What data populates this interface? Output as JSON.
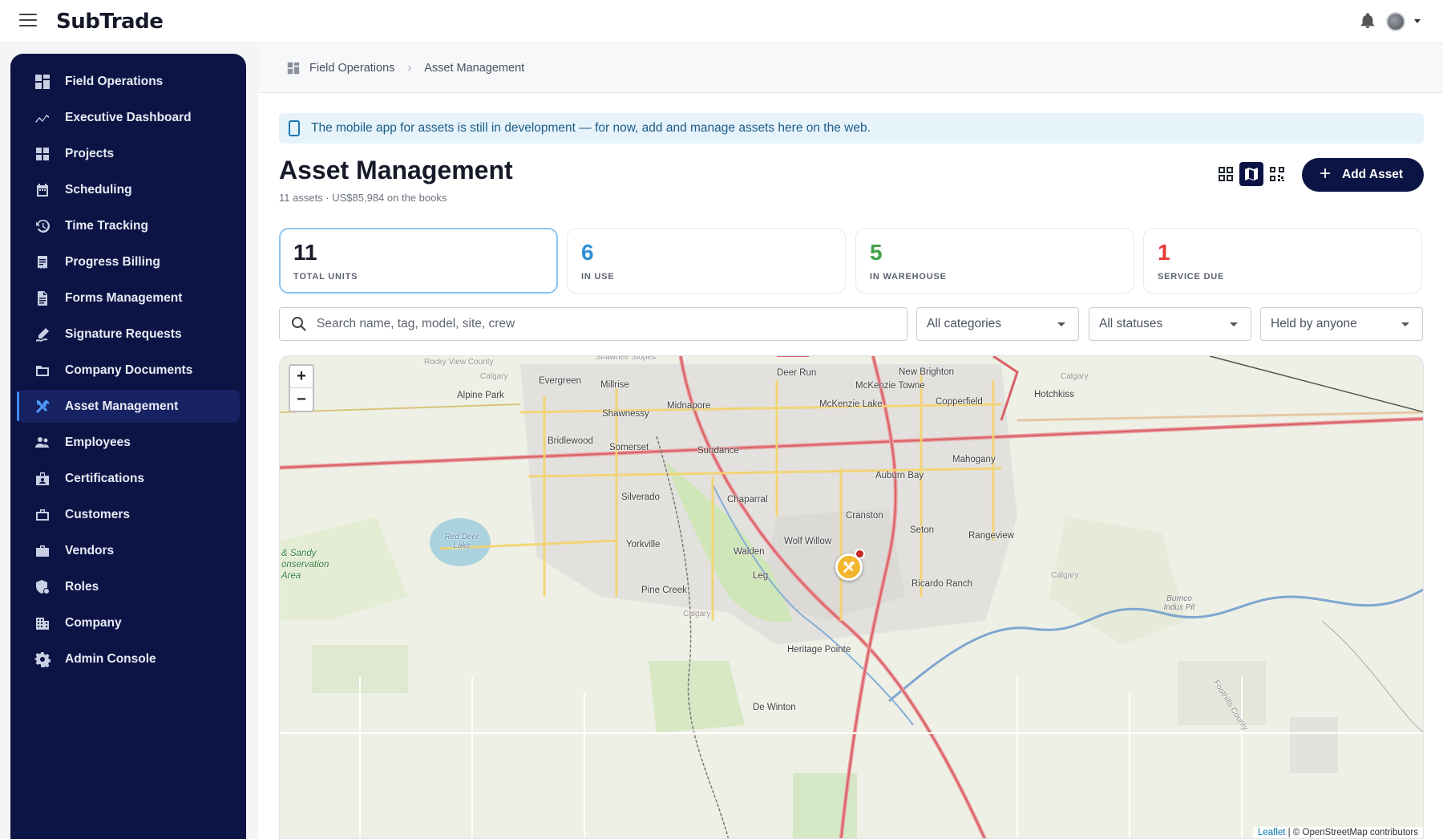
{
  "app": {
    "brand": "SubTrade"
  },
  "sidebar": {
    "items": [
      {
        "label": "Field Operations",
        "icon": "dashboard-grid-icon"
      },
      {
        "label": "Executive Dashboard",
        "icon": "trend-chart-icon"
      },
      {
        "label": "Projects",
        "icon": "projects-grid-icon"
      },
      {
        "label": "Scheduling",
        "icon": "calendar-icon"
      },
      {
        "label": "Time Tracking",
        "icon": "history-clock-icon"
      },
      {
        "label": "Progress Billing",
        "icon": "receipt-icon"
      },
      {
        "label": "Forms Management",
        "icon": "document-icon"
      },
      {
        "label": "Signature Requests",
        "icon": "signature-pen-icon"
      },
      {
        "label": "Company Documents",
        "icon": "folder-icon"
      },
      {
        "label": "Asset Management",
        "icon": "tools-icon",
        "active": true
      },
      {
        "label": "Employees",
        "icon": "people-icon"
      },
      {
        "label": "Certifications",
        "icon": "badge-icon"
      },
      {
        "label": "Customers",
        "icon": "briefcase-icon"
      },
      {
        "label": "Vendors",
        "icon": "store-icon"
      },
      {
        "label": "Roles",
        "icon": "shield-user-icon"
      },
      {
        "label": "Company",
        "icon": "building-icon"
      },
      {
        "label": "Admin Console",
        "icon": "gear-icon"
      }
    ]
  },
  "breadcrumb": {
    "root": "Field Operations",
    "current": "Asset Management"
  },
  "banner": {
    "text": "The mobile app for assets is still in development — for now, add and manage assets here on the web."
  },
  "page": {
    "title": "Asset Management",
    "subtitle": "11 assets · US$85,984 on the books"
  },
  "toolbar": {
    "add_label": "Add Asset",
    "views": [
      "grid-view-icon",
      "map-view-icon",
      "qr-code-icon"
    ],
    "active_view": "map-view-icon"
  },
  "stats": [
    {
      "value": "11",
      "label": "TOTAL UNITS",
      "color": "#161a28"
    },
    {
      "value": "6",
      "label": "IN USE",
      "color": "#2e8fd6"
    },
    {
      "value": "5",
      "label": "IN WAREHOUSE",
      "color": "#43a047"
    },
    {
      "value": "1",
      "label": "SERVICE DUE",
      "color": "#e53935"
    }
  ],
  "filters": {
    "search_placeholder": "Search name, tag, model, site, crew",
    "category": "All categories",
    "status": "All statuses",
    "holder": "Held by anyone"
  },
  "map": {
    "zoom_in": "+",
    "zoom_out": "−",
    "labels": {
      "evergreen": "Evergreen",
      "millrise": "Millrise",
      "alpine_park": "Alpine Park",
      "shawnessy": "Shawnessy",
      "midnapore": "Midnapore",
      "bridlewood": "Bridlewood",
      "somerset": "Somerset",
      "sundance": "Sundance",
      "deer_run": "Deer Run",
      "new_brighton": "New Brighton",
      "mckenzie_towne": "McKenzie Towne",
      "mckenzie_lake": "McKenzie Lake",
      "copperfield": "Copperfield",
      "hotchkiss": "Hotchkiss",
      "mahogany": "Mahogany",
      "auburn_bay": "Auburn Bay",
      "chaparral": "Chaparral",
      "silverado": "Silverado",
      "cranston": "Cranston",
      "seton": "Seton",
      "rangeview": "Rangeview",
      "yorkville": "Yorkville",
      "wolf_willow": "Wolf Willow",
      "walden": "Walden",
      "legacy": "Leg",
      "pine_creek": "Pine Creek",
      "ricardo_ranch": "Ricardo Ranch",
      "heritage_pointe": "Heritage Pointe",
      "de_winton": "De Winton",
      "calgary1": "Calgary",
      "calgary2": "Calgary",
      "calgary3": "Calgary",
      "calgary4": "Calgary",
      "rocky_view": "Rocky View County",
      "shawnee": "Shawnee Slopes",
      "red_deer_lake": "Red Deer Lake",
      "burnco": "Burnco Indus Pit",
      "foothills": "Foothills County",
      "sandy_line1": "& Sandy",
      "sandy_line2": "onservation",
      "sandy_line3": "Area"
    },
    "attribution_leaflet": "Leaflet",
    "attribution_rest": " | © OpenStreetMap contributors"
  }
}
